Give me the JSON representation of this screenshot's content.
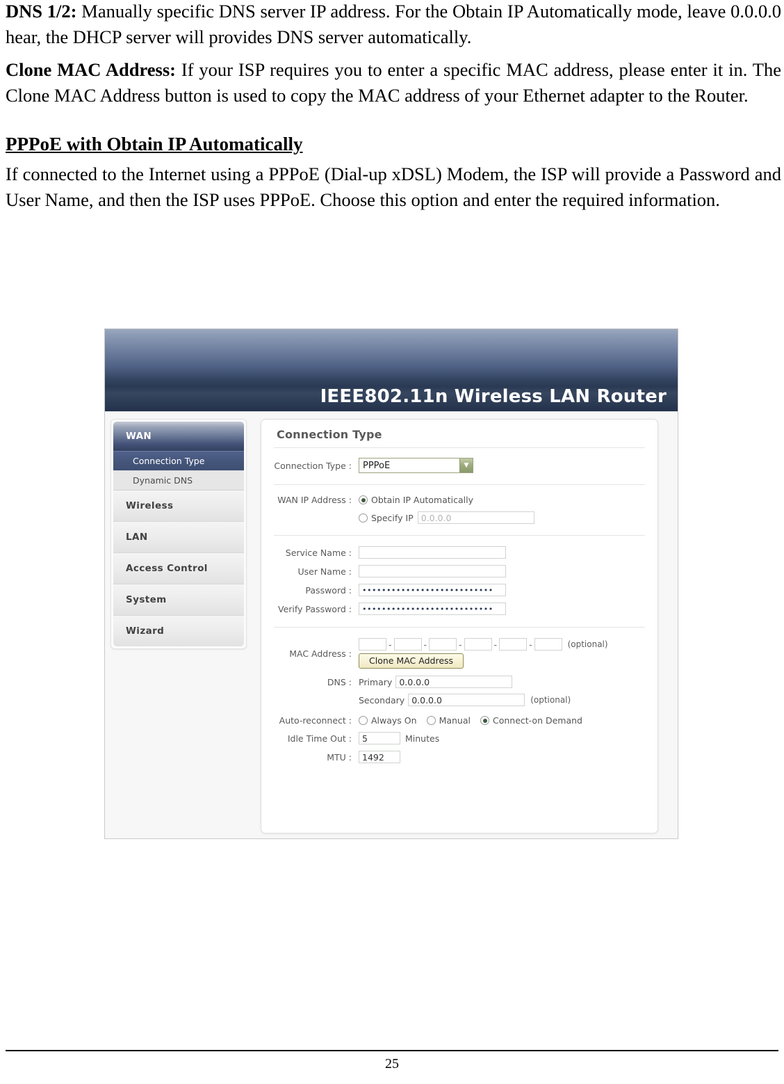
{
  "document": {
    "paragraphs": [
      {
        "lead": "DNS 1/2:",
        "text": " Manually specific DNS server IP address. For the Obtain IP Automatically mode, leave 0.0.0.0 hear, the DHCP server will provides DNS server automatically."
      },
      {
        "lead": "Clone MAC Address:",
        "text": " If your ISP requires you to enter a specific MAC address, please enter it in. The Clone MAC Address button is used to copy the MAC address of your Ethernet adapter to the Router."
      }
    ],
    "section_heading": "PPPoE with Obtain IP Automatically",
    "section_paragraph": "If connected to the Internet using a PPPoE (Dial-up xDSL) Modem, the ISP will provide a Password and User Name, and then the ISP uses PPPoE. Choose this option and enter the required information.",
    "page_number": "25"
  },
  "screenshot": {
    "banner": {
      "title": "IEEE802.11n  Wireless LAN Router"
    },
    "sidebar": {
      "group_label": "WAN",
      "sub_items": [
        {
          "label": "Connection Type",
          "active": true
        },
        {
          "label": "Dynamic DNS",
          "active": false
        }
      ],
      "items": [
        {
          "label": "Wireless"
        },
        {
          "label": "LAN"
        },
        {
          "label": "Access Control"
        },
        {
          "label": "System"
        },
        {
          "label": "Wizard"
        }
      ]
    },
    "panel": {
      "title": "Connection Type",
      "connection_type": {
        "label": "Connection Type :",
        "value": "PPPoE",
        "arrow_icon": "chevron-down-icon"
      },
      "wan_ip": {
        "label": "WAN IP Address :",
        "option_auto": "Obtain IP Automatically",
        "option_specify": "Specify IP",
        "specify_value": "0.0.0.0",
        "selected": "auto"
      },
      "service_name": {
        "label": "Service Name :",
        "value": ""
      },
      "user_name": {
        "label": "User Name :",
        "value": ""
      },
      "password": {
        "label": "Password :",
        "value": "•••••••••••••••••••••••••••"
      },
      "verify_password": {
        "label": "Verify Password :",
        "value": "•••••••••••••••••••••••••••"
      },
      "mac_address": {
        "label": "MAC Address :",
        "octets": [
          "",
          "",
          "",
          "",
          "",
          ""
        ],
        "separator": "-",
        "optional_note": "(optional)",
        "clone_button": "Clone MAC Address"
      },
      "dns": {
        "label": "DNS :",
        "primary_label": "Primary",
        "primary_value": "0.0.0.0",
        "secondary_label": "Secondary",
        "secondary_value": "0.0.0.0",
        "secondary_note": "(optional)"
      },
      "auto_reconnect": {
        "label": "Auto-reconnect :",
        "options": [
          "Always On",
          "Manual",
          "Connect-on Demand"
        ],
        "selected": "Connect-on Demand"
      },
      "idle_timeout": {
        "label": "Idle Time Out :",
        "value": "5",
        "unit": "Minutes"
      },
      "mtu": {
        "label": "MTU :",
        "value": "1492"
      }
    },
    "colors": {
      "banner_dark": "#23314a",
      "banner_light": "#9aa7be",
      "nav_active": "#45547a",
      "select_border": "#9aa47f",
      "button_face": "#f7f2d6"
    }
  }
}
